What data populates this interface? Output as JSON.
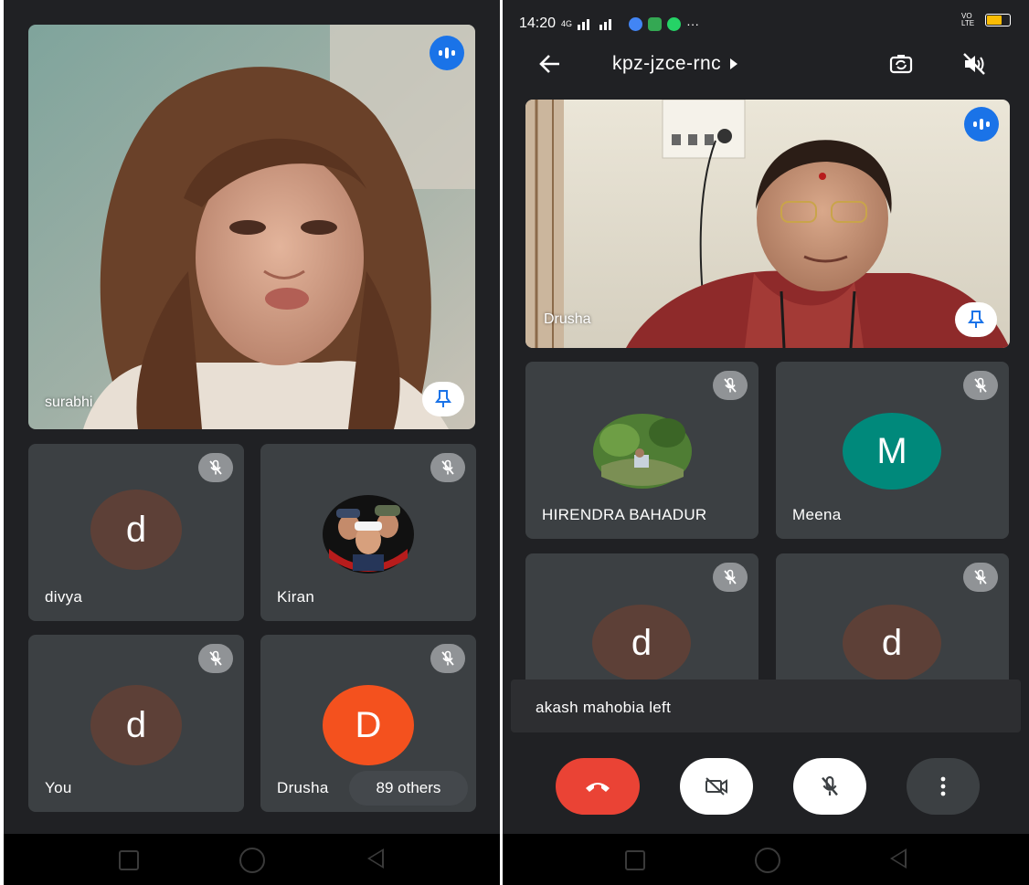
{
  "left_screen": {
    "main_video": {
      "name": "surabhi"
    },
    "tiles": [
      {
        "name": "divya",
        "avatar_letter": "d",
        "avatar_color": "#5d4037"
      },
      {
        "name": "Kiran",
        "avatar_image": "kiran-profile-photo"
      },
      {
        "name": "You",
        "avatar_letter": "d",
        "avatar_color": "#5d4037"
      },
      {
        "name": "Drusha",
        "avatar_letter": "D",
        "avatar_color": "#f4511e",
        "others_label": "89 others"
      }
    ]
  },
  "right_screen": {
    "status_bar": {
      "time": "14:20",
      "network": "4G",
      "volte": "VO LTE"
    },
    "header": {
      "meeting_code": "kpz-jzce-rnc"
    },
    "main_video": {
      "name": "Drusha"
    },
    "tiles": [
      {
        "name": "HIRENDRA BAHADUR",
        "avatar_image": "landscape-photo"
      },
      {
        "name": "Meena",
        "avatar_letter": "M",
        "avatar_color": "#00897b"
      },
      {
        "name": "",
        "avatar_letter": "d",
        "avatar_color": "#5d4037"
      },
      {
        "name": "",
        "avatar_letter": "d",
        "avatar_color": "#5d4037"
      }
    ],
    "notification": "akash mahobia left",
    "controls": {
      "end_call_color": "#ea4335"
    }
  },
  "colors": {
    "background": "#202124",
    "tile": "#3c4043",
    "accent": "#1a73e8"
  }
}
